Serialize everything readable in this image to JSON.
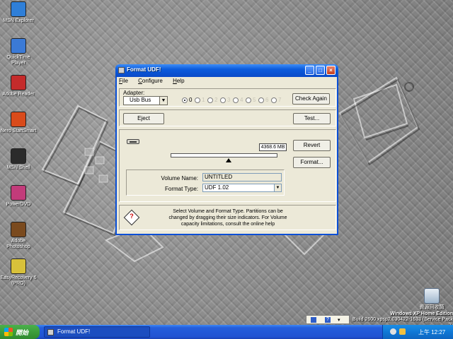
{
  "desktop": {
    "icons": [
      {
        "label": "MSN Explorer",
        "color": "#2f7fd8"
      },
      {
        "label": "QuickTime Player",
        "color": "#3b7ad6"
      },
      {
        "label": "Adobe Reader",
        "color": "#c42b2b"
      },
      {
        "label": "Nero StartSmart",
        "color": "#d94b1b"
      },
      {
        "label": "MSN Shell",
        "color": "#2b2b2b"
      },
      {
        "label": "PowerDVD",
        "color": "#c23b7a"
      },
      {
        "label": "Adobe Photoshop",
        "color": "#7a4a1e"
      },
      {
        "label": "EasyRecovery 6 (PRO)",
        "color": "#d8c13a"
      }
    ],
    "recycle_bin_label": "資源回收筒",
    "windows_version_line1": "Windows XP Home Edition",
    "windows_version_line2": "Build 2600.xpsp2.030422-1633 (Service Pack 2)"
  },
  "window": {
    "title": "Format UDF!",
    "menu": [
      {
        "key": "F",
        "rest": "ile"
      },
      {
        "key": "C",
        "rest": "onfigure"
      },
      {
        "key": "H",
        "rest": "elp"
      }
    ],
    "adapter": {
      "label": "Adapter:",
      "selected": "Usb Bus",
      "ids": [
        "0",
        "1",
        "2",
        "3",
        "4",
        "5",
        "6",
        "7"
      ],
      "selected_id": "0",
      "check_again_label": "Check Again"
    },
    "eject_label": "Eject",
    "test_label": "Test...",
    "drive": {
      "size": "4368.6 MB",
      "revert_label": "Revert",
      "format_label": "Format...",
      "volume_name_label": "Volume Name:",
      "volume_name": "UNTITLED",
      "format_type_label": "Format Type:",
      "format_type": "UDF 1.02"
    },
    "help": {
      "icon": "question-icon",
      "line1": "Select Volume and Format Type. Partitions can be",
      "line2": "changed by dragging their size indicators. For Volume",
      "line3": "capacity limitations, consult the online help"
    }
  },
  "taskbar": {
    "start_label": "開始",
    "task_label": "Format UDF!",
    "clock": "上午 12:27"
  },
  "colors": {
    "title_blue": "#0b5bdc",
    "start_green": "#3c9d3c",
    "window_face": "#ece9d8"
  }
}
